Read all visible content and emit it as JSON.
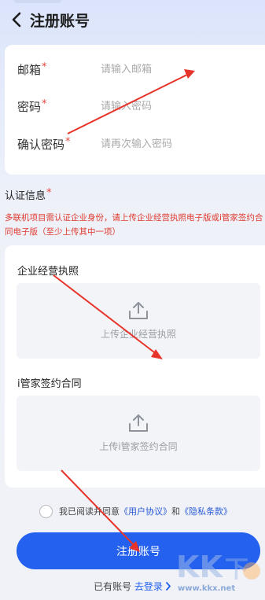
{
  "header": {
    "title": "注册账号"
  },
  "form": {
    "email": {
      "label": "邮箱",
      "required_mark": "*",
      "placeholder": "请输入邮箱",
      "value": ""
    },
    "password": {
      "label": "密码",
      "required_mark": "*",
      "placeholder": "请输入密码",
      "value": ""
    },
    "confirm_password": {
      "label": "确认密码",
      "required_mark": "*",
      "placeholder": "请再次输入密码",
      "value": ""
    }
  },
  "certification": {
    "title": "认证信息",
    "required_mark": "*",
    "note": "多联机项目需认证企业身份，请上传企业经营执照电子版或i管家签约合同电子版（至少上传其中一项）",
    "business_license": {
      "label": "企业经营执照",
      "upload_text": "上传企业经营执照"
    },
    "contract": {
      "label": "i管家签约合同",
      "upload_text": "上传i管家签约合同"
    }
  },
  "agreement": {
    "prefix": "我已阅读并同意",
    "user_agreement": "《用户协议》",
    "conjunction": "和",
    "privacy_policy": "《隐私条款》",
    "checked": false
  },
  "actions": {
    "register_label": "注册账号",
    "login_prompt": "已有账号",
    "login_link": "去登录"
  },
  "watermark": {
    "url": "www.kkx.net"
  },
  "colors": {
    "accent": "#2361ee",
    "required": "#e8453c",
    "annotation_arrow": "#e8332a"
  }
}
